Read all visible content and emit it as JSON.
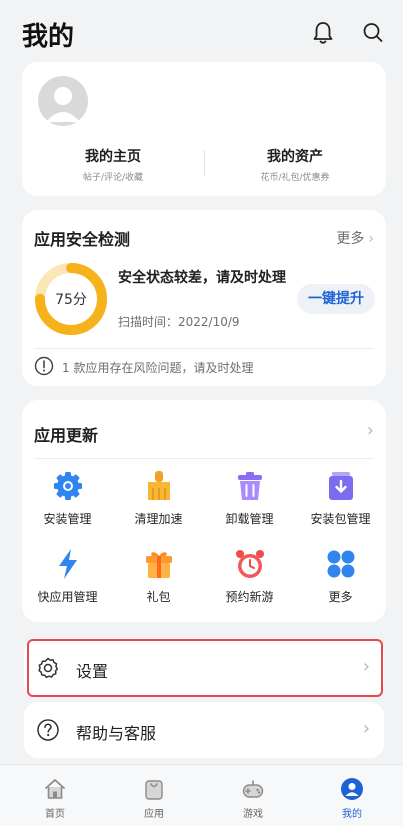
{
  "header": {
    "title": "我的",
    "icons": [
      "bell-icon",
      "search-icon"
    ]
  },
  "profile": {
    "homepage_title": "我的主页",
    "homepage_sub": "帖子/评论/收藏",
    "assets_title": "我的资产",
    "assets_sub": "花币/礼包/优惠券"
  },
  "security": {
    "title": "应用安全检测",
    "more": "更多",
    "score": 75,
    "score_label": "75分",
    "status": "安全状态较差，请及时处理",
    "scan_time": "扫描时间：2022/10/9",
    "fix_button": "一键提升",
    "warning": "1 款应用存在风险问题，请及时处理",
    "gauge_color": "#f6b21b",
    "gauge_track_color": "#fbe7b5"
  },
  "updates": {
    "title": "应用更新",
    "items": [
      {
        "label": "安装管理",
        "icon": "gear-icon"
      },
      {
        "label": "清理加速",
        "icon": "broom-icon"
      },
      {
        "label": "卸载管理",
        "icon": "trash-icon"
      },
      {
        "label": "安装包管理",
        "icon": "package-icon"
      },
      {
        "label": "快应用管理",
        "icon": "lightning-icon"
      },
      {
        "label": "礼包",
        "icon": "gift-icon"
      },
      {
        "label": "预约新游",
        "icon": "alarm-clock-icon"
      },
      {
        "label": "更多",
        "icon": "grid-icon"
      }
    ]
  },
  "rows": {
    "settings": "设置",
    "help": "帮助与客服"
  },
  "bottom_nav": {
    "items": [
      {
        "label": "首页",
        "icon": "home-icon"
      },
      {
        "label": "应用",
        "icon": "bag-icon"
      },
      {
        "label": "游戏",
        "icon": "gamepad-icon"
      },
      {
        "label": "我的",
        "icon": "user-icon",
        "active": true
      }
    ]
  },
  "colors": {
    "accent_blue": "#1e63d6",
    "highlight_red": "#e84850"
  }
}
